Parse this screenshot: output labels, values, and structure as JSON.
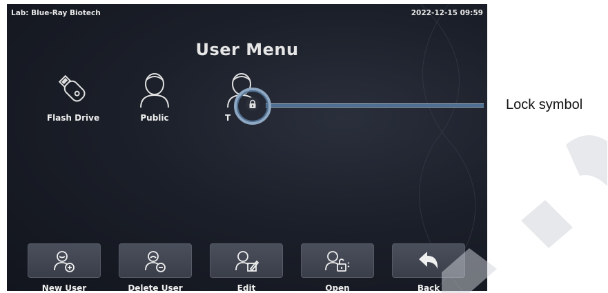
{
  "status": {
    "lab": "Lab: Blue-Ray Biotech",
    "datetime": "2022-12-15 09:59"
  },
  "title": "User Menu",
  "users": [
    {
      "label": "Flash Drive",
      "icon": "usb-drive-icon"
    },
    {
      "label": "Public",
      "icon": "user-icon"
    },
    {
      "label": "T",
      "icon": "user-icon",
      "locked": true
    }
  ],
  "buttons": [
    {
      "label": "New User",
      "icon": "add-user-icon"
    },
    {
      "label": "Delete User",
      "icon": "remove-user-icon"
    },
    {
      "label": "Edit",
      "icon": "edit-user-icon"
    },
    {
      "label": "Open",
      "icon": "unlock-user-icon"
    },
    {
      "label": "Back",
      "icon": "back-arrow-icon"
    }
  ],
  "callout": {
    "label": "Lock symbol",
    "color": "#4f6f92"
  },
  "colors": {
    "screen_bg": "#1b1f29",
    "button_bg": "#3a3e49",
    "text": "#f0f0f0"
  }
}
